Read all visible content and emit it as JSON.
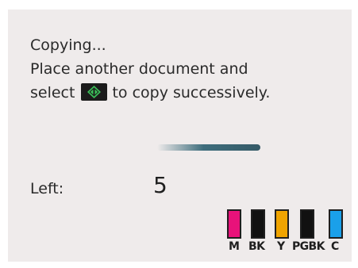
{
  "message": {
    "line1": "Copying...",
    "line2": "Place another document and",
    "line3_before": "select",
    "line3_after": "to copy successively.",
    "start_icon": "start-diamond-icon"
  },
  "progress_label": "",
  "remaining": {
    "label": "Left:",
    "value": "5"
  },
  "ink_levels": [
    {
      "label": "M",
      "color": "#e8127a",
      "level": 1.0
    },
    {
      "label": "BK",
      "color": "#111111",
      "level": 1.0
    },
    {
      "label": "Y",
      "color": "#f0a400",
      "level": 1.0
    },
    {
      "label": "PGBK",
      "color": "#111111",
      "level": 1.0
    },
    {
      "label": "C",
      "color": "#1aa0ea",
      "level": 1.0
    }
  ]
}
